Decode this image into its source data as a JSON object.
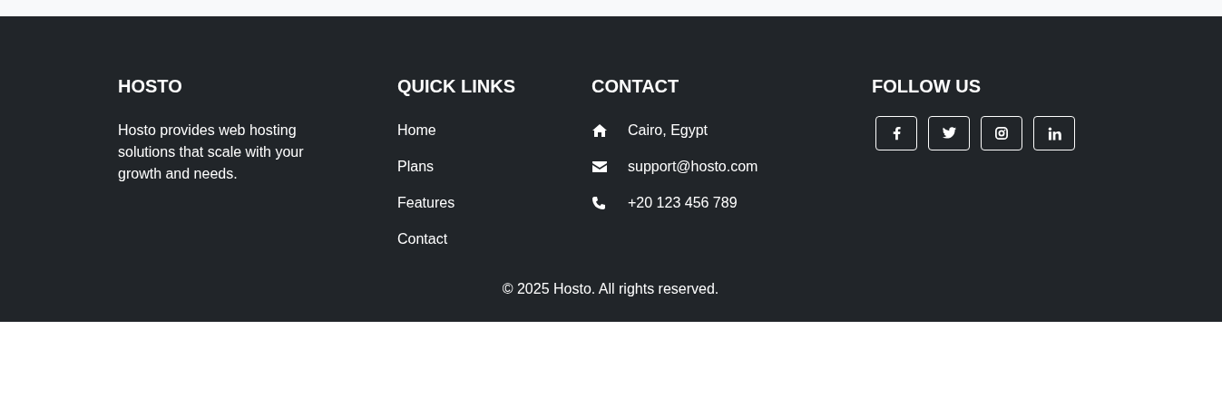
{
  "brand": {
    "heading": "HOSTO",
    "description": "Hosto provides web hosting solutions that scale with your growth and needs."
  },
  "quick_links": {
    "heading": "QUICK LINKS",
    "items": [
      "Home",
      "Plans",
      "Features",
      "Contact"
    ]
  },
  "contact": {
    "heading": "CONTACT",
    "items": [
      {
        "kind": "address",
        "text": "Cairo, Egypt"
      },
      {
        "kind": "email",
        "text": "support@hosto.com"
      },
      {
        "kind": "phone",
        "text": "+20 123 456 789"
      }
    ]
  },
  "follow": {
    "heading": "FOLLOW US",
    "items": [
      {
        "kind": "facebook"
      },
      {
        "kind": "twitter"
      },
      {
        "kind": "instagram"
      },
      {
        "kind": "linkedin"
      }
    ]
  },
  "copyright": "© 2025 Hosto. All rights reserved."
}
